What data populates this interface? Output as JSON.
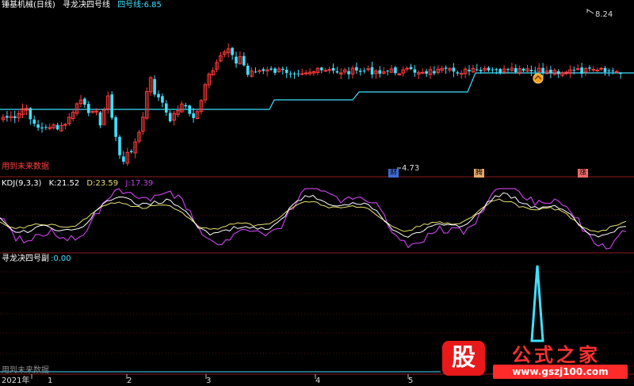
{
  "header": {
    "stock_name": "锤基机械(日线)",
    "indicator_name": "寻龙决四号线",
    "line_label": "四号线:",
    "line_value": "6.85"
  },
  "main_panel": {
    "high_label": "8.24",
    "low_label": "4.73",
    "future_note": "用到未来数据",
    "signals": [
      {
        "label": "财",
        "bg": "#3f6bd8"
      },
      {
        "label": "腾",
        "bg": "#e6a96a"
      },
      {
        "label": "涨",
        "bg": "#f06a6a"
      }
    ],
    "colors": {
      "up": "#ff3a3a",
      "down": "#40e0ff",
      "line": "#40e0ff"
    }
  },
  "kdj_panel": {
    "name": "KDJ(9,3,3)",
    "k_label": "K:",
    "k_value": "21.52",
    "d_label": "D:",
    "d_value": "23.59",
    "j_label": "J:",
    "j_value": "17.39",
    "colors": {
      "k": "#ffffff",
      "d": "#e8e070",
      "j": "#c040e0"
    }
  },
  "sub_panel": {
    "name": "寻龙决四号副",
    "value_label": ":",
    "value": "0.00",
    "future_note": "用到未来数据"
  },
  "time_axis": {
    "year": "2021年",
    "months": [
      "1",
      "2",
      "3",
      "4",
      "5"
    ]
  },
  "watermark": {
    "logo_char": "股",
    "text": "公式之家",
    "url": "www.gszj100.com"
  },
  "chart_data": [
    {
      "type": "candlestick",
      "title": "寻龙决四号线",
      "series": [
        {
          "name": "四号线",
          "value_at_last": 6.85
        }
      ],
      "annotations": [
        {
          "text": "8.24",
          "kind": "high"
        },
        {
          "text": "4.73",
          "kind": "low"
        }
      ]
    },
    {
      "type": "line",
      "title": "KDJ(9,3,3)",
      "series": [
        {
          "name": "K",
          "last": 21.52
        },
        {
          "name": "D",
          "last": 23.59
        },
        {
          "name": "J",
          "last": 17.39
        }
      ]
    },
    {
      "type": "bar",
      "title": "寻龙决四号副",
      "series": [
        {
          "name": "寻龙决四号副",
          "last": 0.0
        }
      ]
    }
  ]
}
